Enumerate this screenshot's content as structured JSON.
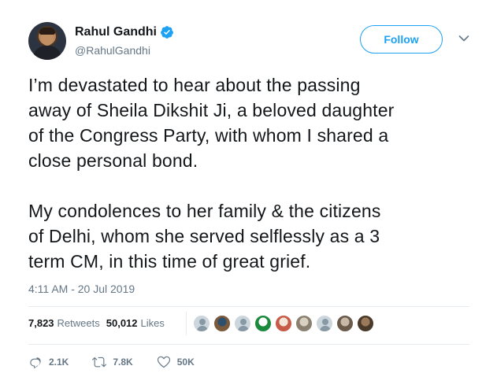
{
  "author": {
    "name": "Rahul Gandhi",
    "handle": "@RahulGandhi",
    "verified": true
  },
  "header": {
    "follow_label": "Follow",
    "more_icon": "chevron-down-icon"
  },
  "tweet": {
    "text": "I’m devastated to hear about the passing\naway of Sheila Dikshit Ji, a beloved daughter\nof the Congress Party, with whom I shared a\nclose personal bond.\n\nMy condolences to her family & the citizens\nof Delhi, whom she served selflessly as a 3\nterm CM, in this time of great grief.",
    "timestamp": "4:11 AM - 20 Jul 2019"
  },
  "stats": {
    "retweets_count": "7,823",
    "retweets_label": "Retweets",
    "likes_count": "50,012",
    "likes_label": "Likes"
  },
  "liked_by": [
    {
      "type": "default"
    },
    {
      "type": "photo",
      "color_a": "#7a5a3a",
      "color_b": "#2f4f6f"
    },
    {
      "type": "default"
    },
    {
      "type": "photo",
      "color_a": "#1c8a3c",
      "color_b": "#ffffff"
    },
    {
      "type": "photo",
      "color_a": "#c85a4a",
      "color_b": "#f2e6d8"
    },
    {
      "type": "photo",
      "color_a": "#8a8070",
      "color_b": "#d8d0c0"
    },
    {
      "type": "default"
    },
    {
      "type": "photo",
      "color_a": "#6a5a4a",
      "color_b": "#c8b8a8"
    },
    {
      "type": "photo",
      "color_a": "#4a3a2a",
      "color_b": "#9a7a5a"
    }
  ],
  "actions": {
    "reply_count": "2.1K",
    "retweet_count": "7.8K",
    "like_count": "50K"
  },
  "colors": {
    "accent": "#1da1f2",
    "text": "#14171a",
    "muted": "#657786",
    "divider": "#e6ecf0"
  }
}
